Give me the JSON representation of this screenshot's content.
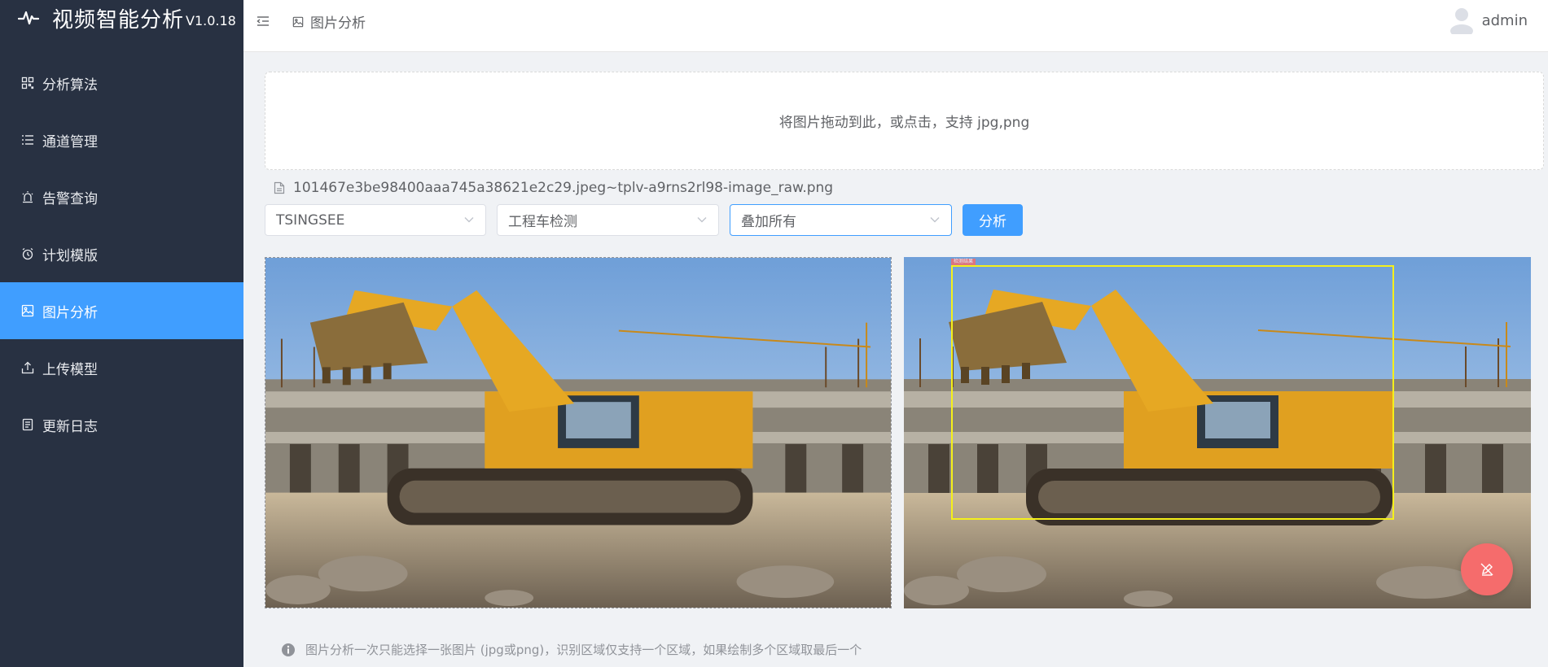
{
  "app": {
    "title": "视频智能分析",
    "version": "V1.0.18"
  },
  "sidebar": {
    "items": [
      {
        "label": "分析算法",
        "icon": "grid-icon"
      },
      {
        "label": "通道管理",
        "icon": "list-icon"
      },
      {
        "label": "告警查询",
        "icon": "alarm-icon"
      },
      {
        "label": "计划模版",
        "icon": "alarm-clock-icon"
      },
      {
        "label": "图片分析",
        "icon": "picture-icon",
        "active": true
      },
      {
        "label": "上传模型",
        "icon": "upload-icon"
      },
      {
        "label": "更新日志",
        "icon": "document-icon"
      }
    ]
  },
  "header": {
    "breadcrumb": "图片分析",
    "username": "admin"
  },
  "upload": {
    "hint": "将图片拖动到此，或点击，支持 jpg,png"
  },
  "file": {
    "name": "101467e3be98400aaa745a38621e2c29.jpeg~tplv-a9rns2rl98-image_raw.png"
  },
  "controls": {
    "vendor": "TSINGSEE",
    "algorithm": "工程车检测",
    "overlay": "叠加所有",
    "analyze_label": "分析"
  },
  "detection": {
    "label": "检测结果"
  },
  "note": {
    "text": "图片分析一次只能选择一张图片 (jpg或png)，识别区域仅支持一个区域，如果绘制多个区域取最后一个"
  },
  "colors": {
    "primary": "#409eff",
    "sidebar_bg": "#283142",
    "danger": "#f56c6c",
    "box": "#f5f01a"
  }
}
